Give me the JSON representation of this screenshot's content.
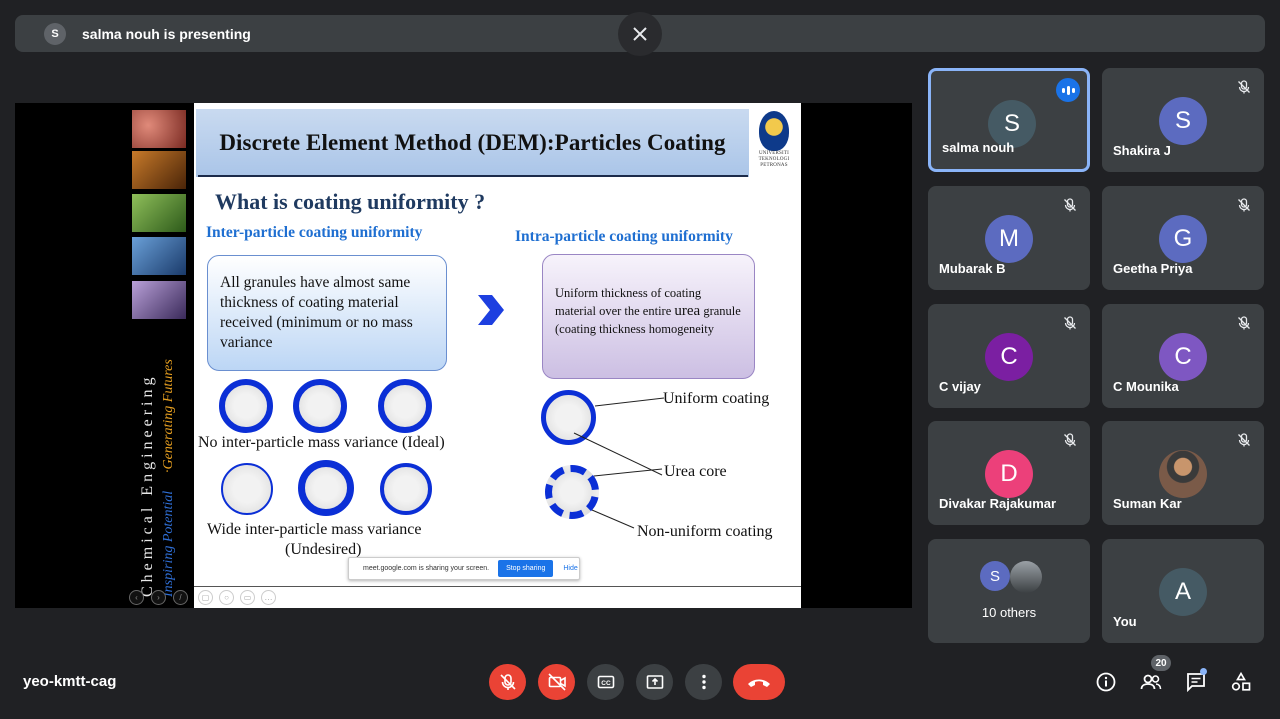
{
  "banner": {
    "avatar_letter": "S",
    "text": "salma nouh is presenting"
  },
  "slide": {
    "title": "Discrete Element Method (DEM):Particles Coating",
    "logo_lines": [
      "UNIVERSITI",
      "TEKNOLOGI",
      "PETRONAS"
    ],
    "question": "What is coating uniformity ?",
    "left_heading": "Inter-particle coating uniformity",
    "right_heading": "Intra-particle coating uniformity",
    "left_box": "All granules have almost same thickness of coating material received  (minimum or no mass variance",
    "right_box_a": "Uniform thickness of coating material over the entire",
    "right_box_big": "urea",
    "right_box_b": "granule (coating thickness homogeneity",
    "caption_ideal": "No inter-particle mass variance (Ideal)",
    "caption_wide": "Wide inter-particle mass variance",
    "caption_undesired": "(Undesired)",
    "label_uniform": "Uniform coating",
    "label_core": "Urea core",
    "label_nonuniform": "Non-uniform coating",
    "side_text_1": "Chemical Engineering",
    "side_text_2": "Inspiring Potential",
    "side_text_3": "·Generating Futures"
  },
  "sharebar": {
    "text": "meet.google.com is sharing your screen.",
    "stop": "Stop sharing",
    "hide": "Hide"
  },
  "participants": [
    {
      "name": "salma nouh",
      "initial": "S",
      "color": "#455a64"
    },
    {
      "name": "Shakira J",
      "initial": "S",
      "color": "#5c6bc0"
    },
    {
      "name": "Mubarak B",
      "initial": "M",
      "color": "#5c6bc0"
    },
    {
      "name": "Geetha Priya",
      "initial": "G",
      "color": "#5c6bc0"
    },
    {
      "name": "C vijay",
      "initial": "C",
      "color": "#7b1fa2"
    },
    {
      "name": "C Mounika",
      "initial": "C",
      "color": "#7e57c2"
    },
    {
      "name": "Divakar Rajakumar",
      "initial": "D",
      "color": "#ec407a"
    },
    {
      "name": "Suman Kar",
      "initial": "",
      "color": "#8d6e63"
    },
    {
      "name": "10 others",
      "initial": "S",
      "color": "#5c6bc0"
    },
    {
      "name": "You",
      "initial": "A",
      "color": "#455a64"
    }
  ],
  "meeting_code": "yeo-kmtt-cag",
  "participant_count": "20",
  "icons": {
    "close": "close-icon",
    "mic_off": "mic-off-icon",
    "cam_off": "camera-off-icon",
    "cc": "captions-icon",
    "present": "present-icon",
    "more": "more-vert-icon",
    "hangup": "hangup-icon",
    "info": "info-icon",
    "people": "people-icon",
    "chat": "chat-icon",
    "activities": "activities-icon"
  }
}
